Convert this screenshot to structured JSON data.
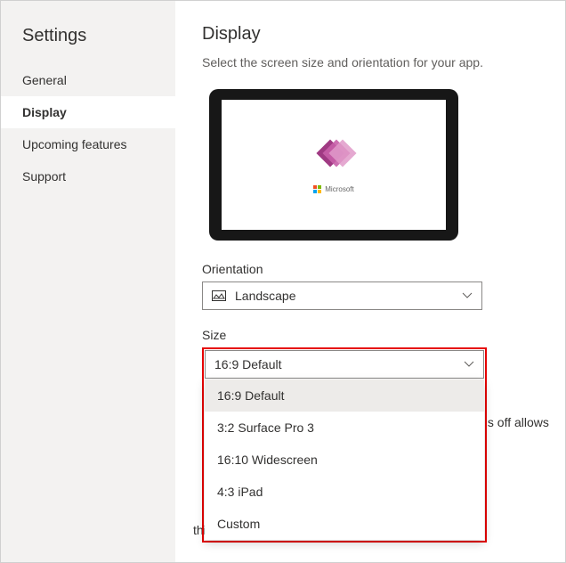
{
  "sidebar": {
    "title": "Settings",
    "items": [
      {
        "label": "General"
      },
      {
        "label": "Display"
      },
      {
        "label": "Upcoming features"
      },
      {
        "label": "Support"
      }
    ]
  },
  "main": {
    "title": "Display",
    "subtitle": "Select the screen size and orientation for your app.",
    "preview_brand": "Microsoft",
    "orientation": {
      "label": "Orientation",
      "value": "Landscape"
    },
    "size": {
      "label": "Size",
      "value": "16:9 Default",
      "options": [
        "16:9 Default",
        "3:2 Surface Pro 3",
        "16:10 Widescreen",
        "4:3 iPad",
        "Custom"
      ]
    },
    "bg_text_right": "his off allows",
    "bg_text_bottom": "this automatically maintains the ratio between height"
  }
}
